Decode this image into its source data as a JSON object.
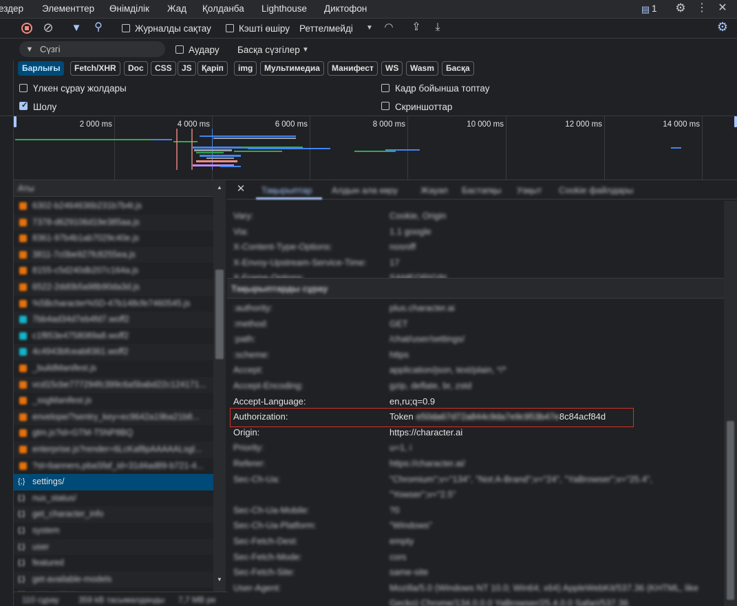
{
  "tabs": [
    "Көздер",
    "Элементтер",
    "Өнімділік",
    "Жад",
    "Қолданба",
    "Lighthouse",
    "Диктофон"
  ],
  "tabs_display": [
    "ездер",
    "Элементтер",
    "Өнімділік",
    "Жад",
    "Қолданба",
    "Lighthouse",
    "Диктофон"
  ],
  "issue_count": "1",
  "toolbar": {
    "preserve_log": "Журналды сақтау",
    "disable_cache": "Кэшті өшіру",
    "throttling": "Реттелмейді"
  },
  "filter": {
    "placeholder": "Сүзгі",
    "invert": "Аудару",
    "more_filters": "Басқа сүзгілер"
  },
  "types": [
    "Барлығы",
    "Fetch/XHR",
    "Doc",
    "CSS",
    "JS",
    "Қаріп",
    "img",
    "Мультимедиа",
    "Манифест",
    "WS",
    "Wasm",
    "Басқа"
  ],
  "options": {
    "big_rows": "Үлкен сұрау жолдары",
    "overview": "Шолу",
    "group_frame": "Кадр бойынша топтау",
    "screenshots": "Скриншоттар"
  },
  "ticks": [
    "2 000 ms",
    "4 000 ms",
    "6 000 ms",
    "8 000 ms",
    "10 000 ms",
    "12 000 ms",
    "14 000 ms"
  ],
  "list_header": "Аты",
  "requests": [
    {
      "name": "6302-b2464636b231b7b4t.js",
      "blur": true,
      "type": "js"
    },
    {
      "name": "7378-d629106d19e385aa.js",
      "blur": true,
      "type": "js"
    },
    {
      "name": "8361-97b4b1ab7029c40e.js",
      "blur": true,
      "type": "js"
    },
    {
      "name": "3811-7c0be927fc8255ea.js",
      "blur": true,
      "type": "js"
    },
    {
      "name": "8155-c5d240db207c164a.js",
      "blur": true,
      "type": "js"
    },
    {
      "name": "6522-2dd0b5a98b90da3d.js",
      "blur": true,
      "type": "js"
    },
    {
      "name": "%5Bcharacter%5D-47b148cfe7460545.js",
      "blur": true,
      "type": "js"
    },
    {
      "name": "7bb4ad34d7eb4fd7.woff2",
      "blur": true,
      "type": "font"
    },
    {
      "name": "c1f853e4758089a8.woff2",
      "blur": true,
      "type": "font"
    },
    {
      "name": "4c4943bfceab8361.woff2",
      "blur": true,
      "type": "font"
    },
    {
      "name": "_buildManifest.js",
      "blur": true,
      "type": "js"
    },
    {
      "name": "vcd15cbe777294fc399c6a5babd22c124171...",
      "blur": true,
      "type": "js"
    },
    {
      "name": "_ssgManifest.js",
      "blur": true,
      "type": "js"
    },
    {
      "name": "envelope/?sentry_key=ec9642a19ba21b8...",
      "blur": true,
      "type": "js"
    },
    {
      "name": "gtm.js?id=GTM-T5NP8BQ",
      "blur": true,
      "type": "js"
    },
    {
      "name": "enterprise.js?render=6LcKaf8pAAAAALsgl...",
      "blur": true,
      "type": "js"
    },
    {
      "name": "?st=banners,pbaSfaf_id=31d4ad89-b721-4...",
      "blur": true,
      "type": "js"
    },
    {
      "name": "settings/",
      "blur": false,
      "type": "xhr",
      "selected": true
    },
    {
      "name": "nux_status/",
      "blur": true,
      "type": "xhr"
    },
    {
      "name": "get_character_info",
      "blur": true,
      "type": "xhr"
    },
    {
      "name": "system",
      "blur": true,
      "type": "xhr"
    },
    {
      "name": "user",
      "blur": true,
      "type": "xhr"
    },
    {
      "name": "featured",
      "blur": true,
      "type": "xhr"
    },
    {
      "name": "get-available-models",
      "blur": true,
      "type": "xhr"
    },
    {
      "name": "user_voices",
      "blur": true,
      "type": "xhr"
    }
  ],
  "detail_tabs": [
    "Тақырыптар",
    "Алдын ала көру",
    "Жауап",
    "Бастапқы",
    "Уақыт",
    "Cookie файлдары"
  ],
  "response_headers": [
    {
      "name": "Vary:",
      "value": "Cookie, Origin",
      "blur": true
    },
    {
      "name": "Via:",
      "value": "1.1 google",
      "blur": true
    },
    {
      "name": "X-Content-Type-Options:",
      "value": "nosniff",
      "blur": true
    },
    {
      "name": "X-Envoy-Upstream-Service-Time:",
      "value": "17",
      "blur": true
    },
    {
      "name": "X-Frame-Options:",
      "value": "SAMEORIGIN",
      "blur": true
    }
  ],
  "request_section": "Тақырыптарды сұрау",
  "request_headers": [
    {
      "name": ":authority:",
      "value": "plus.character.ai",
      "blur": true
    },
    {
      "name": ":method:",
      "value": "GET",
      "blur": true
    },
    {
      "name": ":path:",
      "value": "/chat/user/settings/",
      "blur": true
    },
    {
      "name": ":scheme:",
      "value": "https",
      "blur": true
    },
    {
      "name": "Accept:",
      "value": "application/json, text/plain, */*",
      "blur": true
    },
    {
      "name": "Accept-Encoding:",
      "value": "gzip, deflate, br, zstd",
      "blur": true
    },
    {
      "name": "Accept-Language:",
      "value": "en,ru;q=0.9",
      "blur": false
    },
    {
      "name": "Authorization:",
      "value": "Token",
      "blur": false,
      "token_hidden": "e50da67d72a844c9da7e9c953b47e",
      "token_tail": "8c84acf84d"
    },
    {
      "name": "Origin:",
      "value": "https://character.ai",
      "blur": false
    },
    {
      "name": "Priority:",
      "value": "u=1, i",
      "blur": true
    },
    {
      "name": "Referer:",
      "value": "https://character.ai/",
      "blur": true
    },
    {
      "name": "Sec-Ch-Ua:",
      "value": "\"Chromium\";v=\"134\", \"Not:A-Brand\";v=\"24\", \"YaBrowser\";v=\"25.4\",",
      "blur": true
    },
    {
      "name": "",
      "value": "\"Yowser\";v=\"2.5\"",
      "blur": true
    },
    {
      "name": "Sec-Ch-Ua-Mobile:",
      "value": "?0",
      "blur": true
    },
    {
      "name": "Sec-Ch-Ua-Platform:",
      "value": "\"Windows\"",
      "blur": true
    },
    {
      "name": "Sec-Fetch-Dest:",
      "value": "empty",
      "blur": true
    },
    {
      "name": "Sec-Fetch-Mode:",
      "value": "cors",
      "blur": true
    },
    {
      "name": "Sec-Fetch-Site:",
      "value": "same-site",
      "blur": true
    },
    {
      "name": "User-Agent:",
      "value": "Mozilla/5.0 (Windows NT 10.0; Win64; x64) AppleWebKit/537.36 (KHTML, like",
      "blur": true
    },
    {
      "name": "",
      "value": "Gecko) Chrome/134.0.0.0 YaBrowser/25.4.0.0 Safari/537.36",
      "blur": true
    }
  ],
  "status": {
    "requests": "110 сұрау",
    "transferred": "359 kB тасымалданды",
    "resources": "7,7 MB ре"
  },
  "colors": {
    "accent": "#a8c7fa",
    "selected_row": "#004a77",
    "highlight_box": "#d93025",
    "js_icon": "#e8710a",
    "font_icon": "#12b5cb",
    "xhr_icon": "#e3e3e3"
  }
}
